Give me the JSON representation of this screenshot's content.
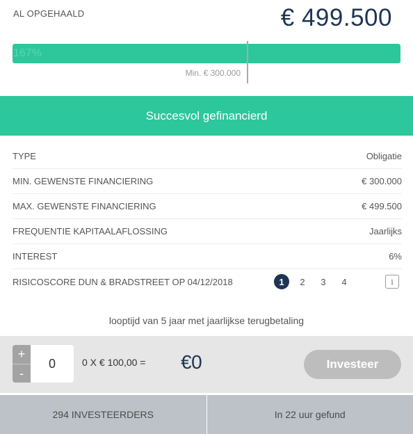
{
  "funding": {
    "raised_label": "AL OPGEHAALD",
    "raised_amount": "€ 499.500",
    "progress_percent": "167%",
    "progress_fill_fraction": 1.0,
    "min_marker_fraction": 0.6,
    "min_label": "Min. € 300.000"
  },
  "banner": {
    "text": "Succesvol gefinancierd"
  },
  "details": {
    "rows": [
      {
        "label": "TYPE",
        "value": "Obligatie"
      },
      {
        "label": "MIN. GEWENSTE FINANCIERING",
        "value": "€ 300.000"
      },
      {
        "label": "MAX. GEWENSTE FINANCIERING",
        "value": "€ 499.500"
      },
      {
        "label": "FREQUENTIE KAPITAALAFLOSSING",
        "value": "Jaarlijks"
      },
      {
        "label": "INTEREST",
        "value": "6%"
      }
    ],
    "risk": {
      "label": "RISICOSCORE DUN & BRADSTREET OP 04/12/2018",
      "scores": [
        "1",
        "2",
        "3",
        "4"
      ],
      "active_score": "1",
      "info_glyph": "i"
    }
  },
  "term_text": "looptijd van 5 jaar met jaarlijkse terugbetaling",
  "invest": {
    "plus": "+",
    "minus": "-",
    "quantity": "0",
    "formula": "0 X € 100,00  =",
    "total": "€0",
    "button_label": "Investeer"
  },
  "footer": {
    "investors": "294 INVESTEERDERS",
    "funded_time": "In 22 uur gefund"
  },
  "colors": {
    "accent": "#2cc79c",
    "navy": "#1e3553",
    "footer_bg": "#bcc2c7"
  }
}
